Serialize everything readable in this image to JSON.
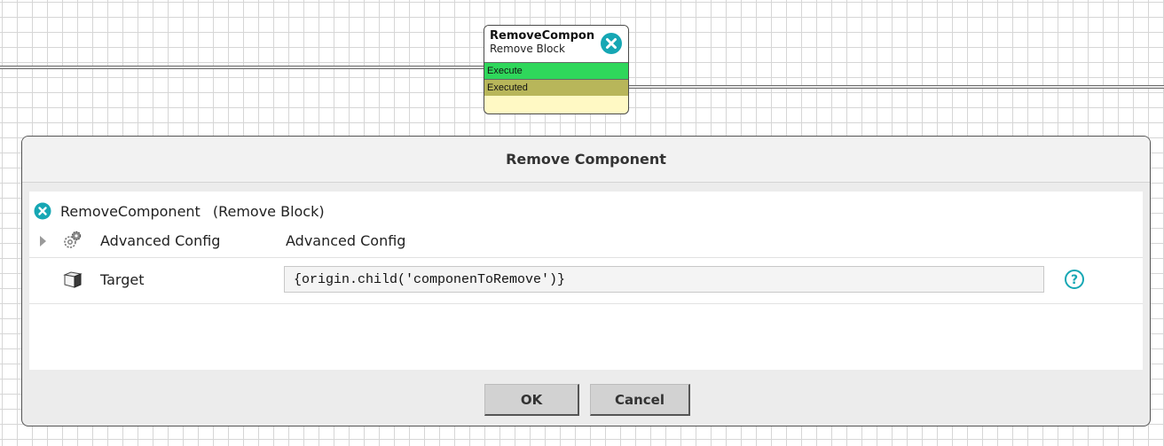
{
  "canvas": {
    "block": {
      "title": "RemoveComponent",
      "subtitle": "Remove Block",
      "ports": [
        "Execute",
        "Executed"
      ],
      "icon": "remove-x-icon"
    }
  },
  "dialog": {
    "title": "Remove Component",
    "component_name": "RemoveComponent",
    "component_type": "(Remove Block)",
    "properties": {
      "advanced": {
        "label": "Advanced Config",
        "value": "Advanced Config",
        "icon": "gear-icon"
      },
      "target": {
        "label": "Target",
        "value": "{origin.child('componenToRemove')}",
        "icon": "cube-icon",
        "help_icon": "help-icon"
      }
    },
    "buttons": {
      "ok": "OK",
      "cancel": "Cancel"
    }
  },
  "colors": {
    "accent_teal": "#16a7b4",
    "execute_port": "#2fd75b",
    "executed_port": "#b8b65a",
    "block_body": "#fff9c4"
  }
}
